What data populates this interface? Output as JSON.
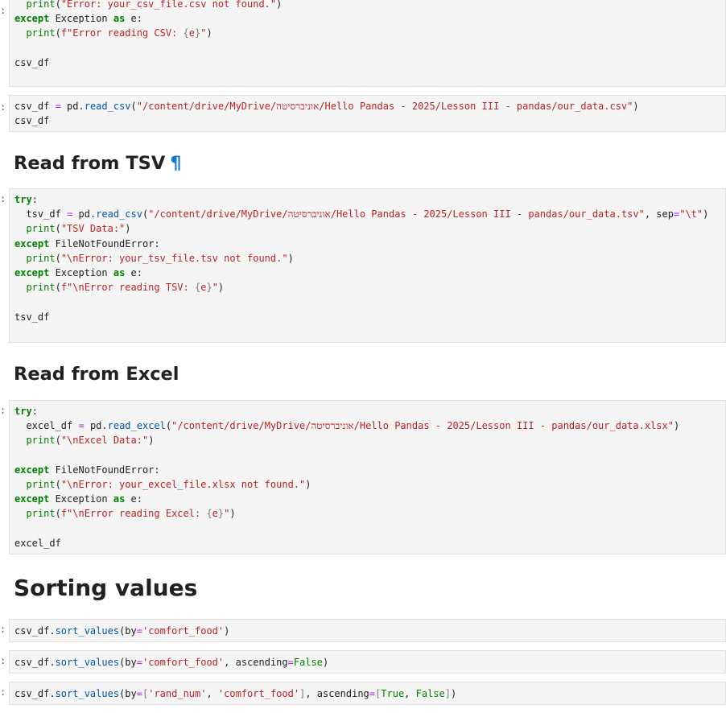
{
  "cells": [
    {
      "id": "cell-1",
      "lines": [
        "  print(\"Error: your_csv_file.csv not found.\")",
        "except Exception as e:",
        "  print(f\"Error reading CSV: {e}\")",
        "",
        "csv_df"
      ]
    },
    {
      "id": "cell-2",
      "lines": [
        "csv_df = pd.read_csv(\"/content/drive/MyDrive/אוניברסיטה/Hello Pandas - 2025/Lesson III - pandas/our_data.csv\")",
        "csv_df"
      ]
    },
    {
      "id": "cell-3",
      "lines": [
        "try:",
        "  tsv_df = pd.read_csv(\"/content/drive/MyDrive/אוניברסיטה/Hello Pandas - 2025/Lesson III - pandas/our_data.tsv\", sep=\"\\t\")",
        "  print(\"TSV Data:\")",
        "except FileNotFoundError:",
        "  print(\"\\nError: your_tsv_file.tsv not found.\")",
        "except Exception as e:",
        "  print(f\"\\nError reading TSV: {e}\")",
        "",
        "tsv_df"
      ]
    },
    {
      "id": "cell-4",
      "lines": [
        "try:",
        "  excel_df = pd.read_excel(\"/content/drive/MyDrive/אוניברסיטה/Hello Pandas - 2025/Lesson III - pandas/our_data.xlsx\")",
        "  print(\"\\nExcel Data:\")",
        "",
        "except FileNotFoundError:",
        "  print(\"\\nError: your_excel_file.xlsx not found.\")",
        "except Exception as e:",
        "  print(f\"\\nError reading Excel: {e}\")",
        "",
        "excel_df"
      ]
    },
    {
      "id": "cell-5",
      "lines": [
        "csv_df.sort_values(by='comfort_food')"
      ]
    },
    {
      "id": "cell-6",
      "lines": [
        "csv_df.sort_values(by='comfort_food', ascending=False)"
      ]
    },
    {
      "id": "cell-7",
      "lines": [
        "csv_df.sort_values(by=['rand_num', 'comfort_food'], ascending=[True, False])"
      ]
    }
  ],
  "headings": {
    "tsv": "Read from TSV",
    "excel": "Read from Excel",
    "sorting": "Sorting values",
    "anchor": "¶"
  },
  "prompt_marker": ":",
  "colors": {
    "keyword": "#008000",
    "string": "#ba2121",
    "function": "#0055aa",
    "operator": "#aa22ff",
    "cell_bg": "#f5f5f5",
    "anchor": "#1976d2"
  }
}
